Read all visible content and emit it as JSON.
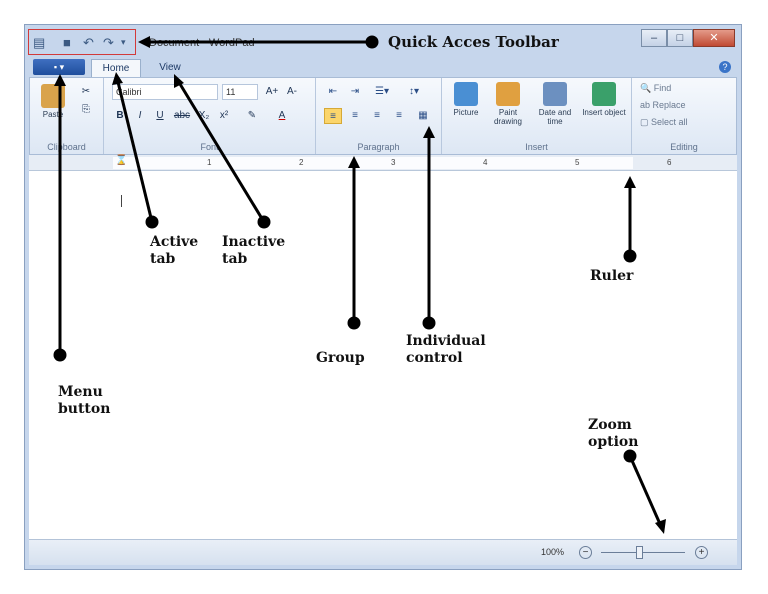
{
  "window": {
    "title": "Document - WordPad",
    "controls": {
      "minimize": "–",
      "maximize": "□",
      "close": "✕"
    }
  },
  "qat": {
    "icons": [
      "save-icon",
      "undo-icon",
      "redo-icon"
    ]
  },
  "tabs": {
    "menu_button": "▪ ▾",
    "active": "Home",
    "inactive": "View",
    "help": "?"
  },
  "ribbon": {
    "clipboard": {
      "label": "Clipboard",
      "paste": "Paste"
    },
    "font": {
      "label": "Font",
      "family": "Calibri",
      "size": "11",
      "bold": "B",
      "italic": "I",
      "underline": "U",
      "strike": "abc",
      "subscript": "X₂",
      "superscript": "x²",
      "grow": "A+",
      "shrink": "A-",
      "color": "A"
    },
    "paragraph": {
      "label": "Paragraph"
    },
    "insert": {
      "label": "Insert",
      "picture": "Picture",
      "paint": "Paint drawing",
      "datetime": "Date and time",
      "object": "Insert object"
    },
    "editing": {
      "label": "Editing",
      "find": "Find",
      "replace": "Replace",
      "select_all": "Select all"
    }
  },
  "ruler": {
    "ticks": [
      "1",
      "2",
      "3",
      "4",
      "5",
      "6"
    ]
  },
  "status": {
    "zoom": "100%"
  },
  "annotations": {
    "qat": "Quick Acces Toolbar",
    "active_tab_1": "Active",
    "active_tab_2": "tab",
    "inactive_tab_1": "Inactive",
    "inactive_tab_2": "tab",
    "ruler": "Ruler",
    "group": "Group",
    "control_1": "Individual",
    "control_2": "control",
    "menu_1": "Menu",
    "menu_2": "button",
    "zoom_1": "Zoom",
    "zoom_2": "option"
  },
  "colors": {
    "accent": "#1f4e9c",
    "highlight": "#fbd56b",
    "frame_red": "#d23a3a"
  }
}
